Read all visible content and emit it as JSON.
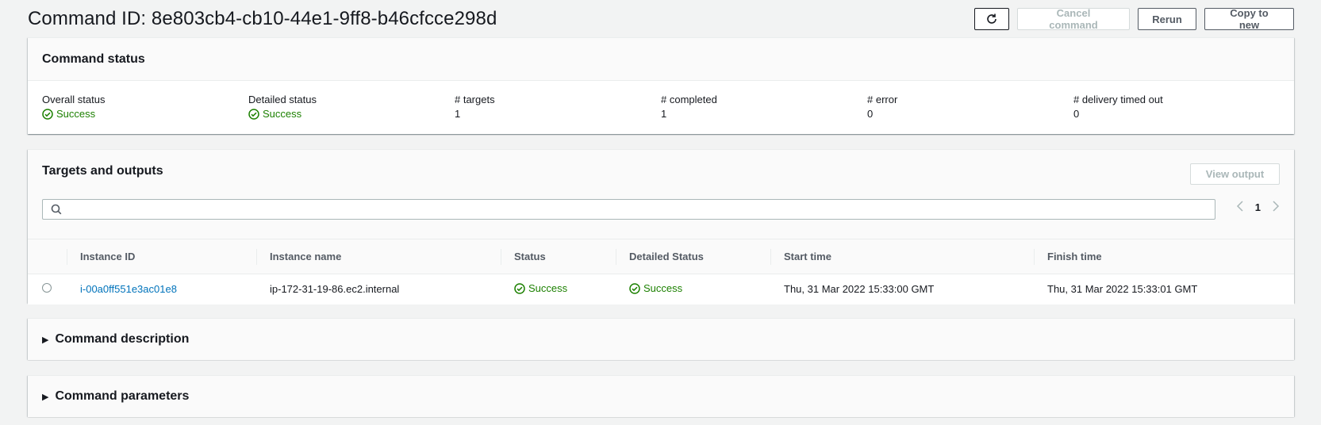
{
  "header": {
    "title": "Command ID: 8e803cb4-cb10-44e1-9ff8-b46cfcce298d",
    "buttons": {
      "refresh": "refresh-icon",
      "cancel": "Cancel command",
      "rerun": "Rerun",
      "copy": "Copy to new"
    }
  },
  "command_status": {
    "title": "Command status",
    "fields": [
      {
        "label": "Overall status",
        "value": "Success"
      },
      {
        "label": "Detailed status",
        "value": "Success"
      },
      {
        "label": "# targets",
        "value": "1"
      },
      {
        "label": "# completed",
        "value": "1"
      },
      {
        "label": "# error",
        "value": "0"
      },
      {
        "label": "# delivery timed out",
        "value": "0"
      }
    ]
  },
  "targets": {
    "title": "Targets and outputs",
    "view_output": "View output",
    "search": {
      "value": "",
      "placeholder": ""
    },
    "pagination": {
      "current_page": "1"
    },
    "columns": [
      "Instance ID",
      "Instance name",
      "Status",
      "Detailed Status",
      "Start time",
      "Finish time"
    ],
    "rows": [
      {
        "instance_id": "i-00a0ff551e3ac01e8",
        "instance_name": "ip-172-31-19-86.ec2.internal",
        "status": "Success",
        "detailed_status": "Success",
        "start_time": "Thu, 31 Mar 2022 15:33:00 GMT",
        "finish_time": "Thu, 31 Mar 2022 15:33:01 GMT"
      }
    ]
  },
  "sections": {
    "description": "Command description",
    "parameters": "Command parameters"
  },
  "colors": {
    "success": "#1d8102",
    "link": "#0073bb",
    "background": "#f2f3f3"
  }
}
